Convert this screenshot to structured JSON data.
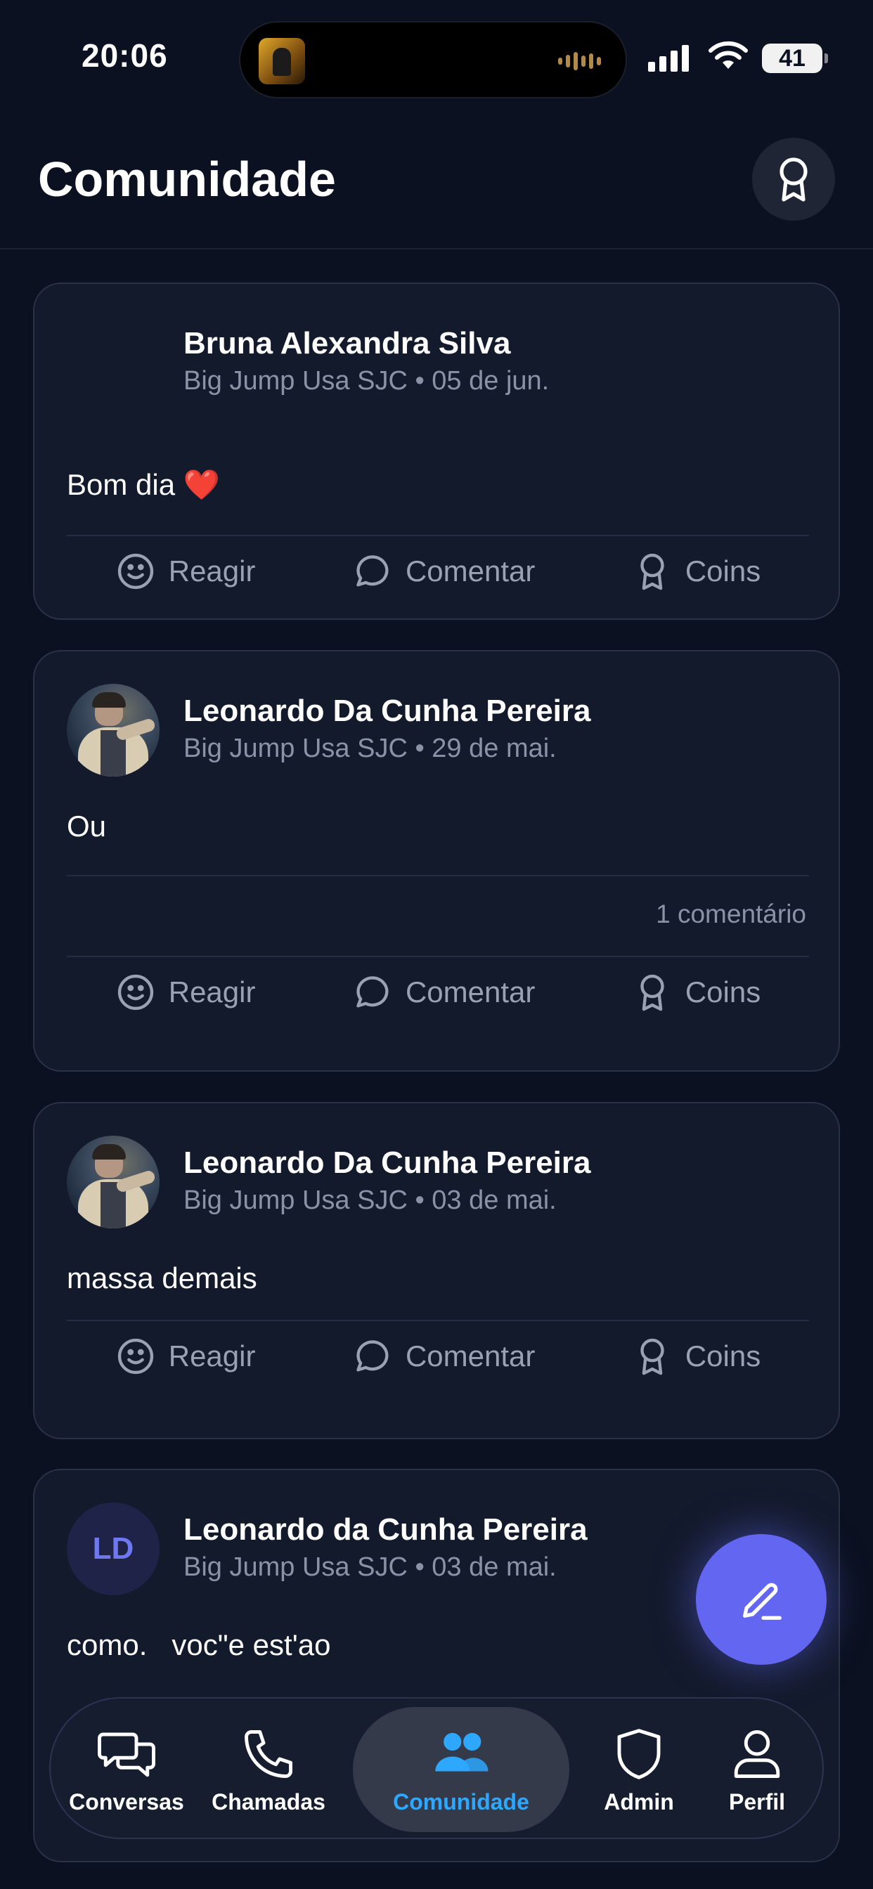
{
  "status_bar": {
    "time": "20:06",
    "battery": "41"
  },
  "header": {
    "title": "Comunidade",
    "icon": "award-icon"
  },
  "posts": [
    {
      "author": "Bruna Alexandra Silva",
      "group": "Big Jump Usa SJC",
      "date": "05 de jun.",
      "meta": "Big Jump Usa SJC • 05 de jun.",
      "text": "Bom dia ❤️",
      "avatar": "none"
    },
    {
      "author": "Leonardo Da Cunha Pereira",
      "group": "Big Jump Usa SJC",
      "date": "29 de mai.",
      "meta": "Big Jump Usa SJC • 29 de mai.",
      "text": "Ou",
      "comments": "1 comentário",
      "avatar": "photo"
    },
    {
      "author": "Leonardo Da Cunha Pereira",
      "group": "Big Jump Usa SJC",
      "date": "03 de mai.",
      "meta": "Big Jump Usa SJC • 03 de mai.",
      "text": "massa demais",
      "avatar": "photo"
    },
    {
      "author": "Leonardo da Cunha Pereira",
      "group": "Big Jump Usa SJC",
      "date": "03 de mai.",
      "meta": "Big Jump Usa SJC • 03 de mai.",
      "text": "como.   voc\"e est'ao",
      "avatar": "initials",
      "initials": "LD"
    }
  ],
  "actions": {
    "react": "Reagir",
    "comment": "Comentar",
    "coins": "Coins"
  },
  "nav": [
    {
      "label": "Conversas",
      "icon": "chat-bubbles-icon",
      "active": false
    },
    {
      "label": "Chamadas",
      "icon": "phone-icon",
      "active": false
    },
    {
      "label": "Comunidade",
      "icon": "users-icon",
      "active": true
    },
    {
      "label": "Admin",
      "icon": "shield-icon",
      "active": false
    },
    {
      "label": "Perfil",
      "icon": "user-icon",
      "active": false
    }
  ],
  "colors": {
    "background": "#0b1120",
    "card": "#131a2c",
    "accent": "#6366f1",
    "active_nav": "#2ea8ff"
  }
}
